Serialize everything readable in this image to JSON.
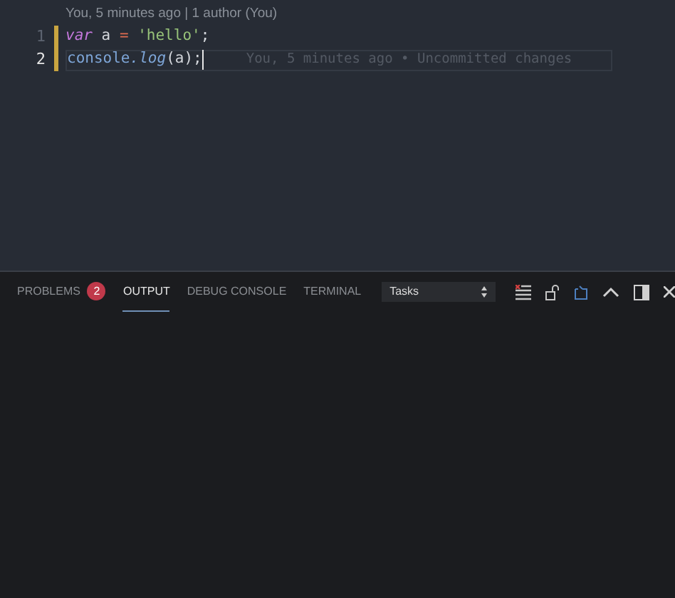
{
  "editor": {
    "codelens": "You, 5 minutes ago | 1 author (You)",
    "lines": [
      {
        "number": "1",
        "current": false,
        "modified": true,
        "tokens": [
          {
            "kind": "keyword",
            "text": "var"
          },
          {
            "kind": "plain",
            "text": " a "
          },
          {
            "kind": "operator",
            "text": "="
          },
          {
            "kind": "string",
            "text": " 'hello'"
          },
          {
            "kind": "plain",
            "text": ";"
          }
        ]
      },
      {
        "number": "2",
        "current": true,
        "modified": true,
        "blame": "You, 5 minutes ago • Uncommitted changes",
        "tokens": [
          {
            "kind": "object",
            "text": "console"
          },
          {
            "kind": "method",
            "text": ".log"
          },
          {
            "kind": "plain",
            "text": "(a);"
          }
        ]
      }
    ]
  },
  "panel": {
    "tabs": [
      {
        "label": "PROBLEMS",
        "selected": false,
        "badge": "2"
      },
      {
        "label": "OUTPUT",
        "selected": true
      },
      {
        "label": "DEBUG CONSOLE",
        "selected": false
      },
      {
        "label": "TERMINAL",
        "selected": false
      }
    ],
    "channel_select": {
      "value": "Tasks"
    }
  }
}
